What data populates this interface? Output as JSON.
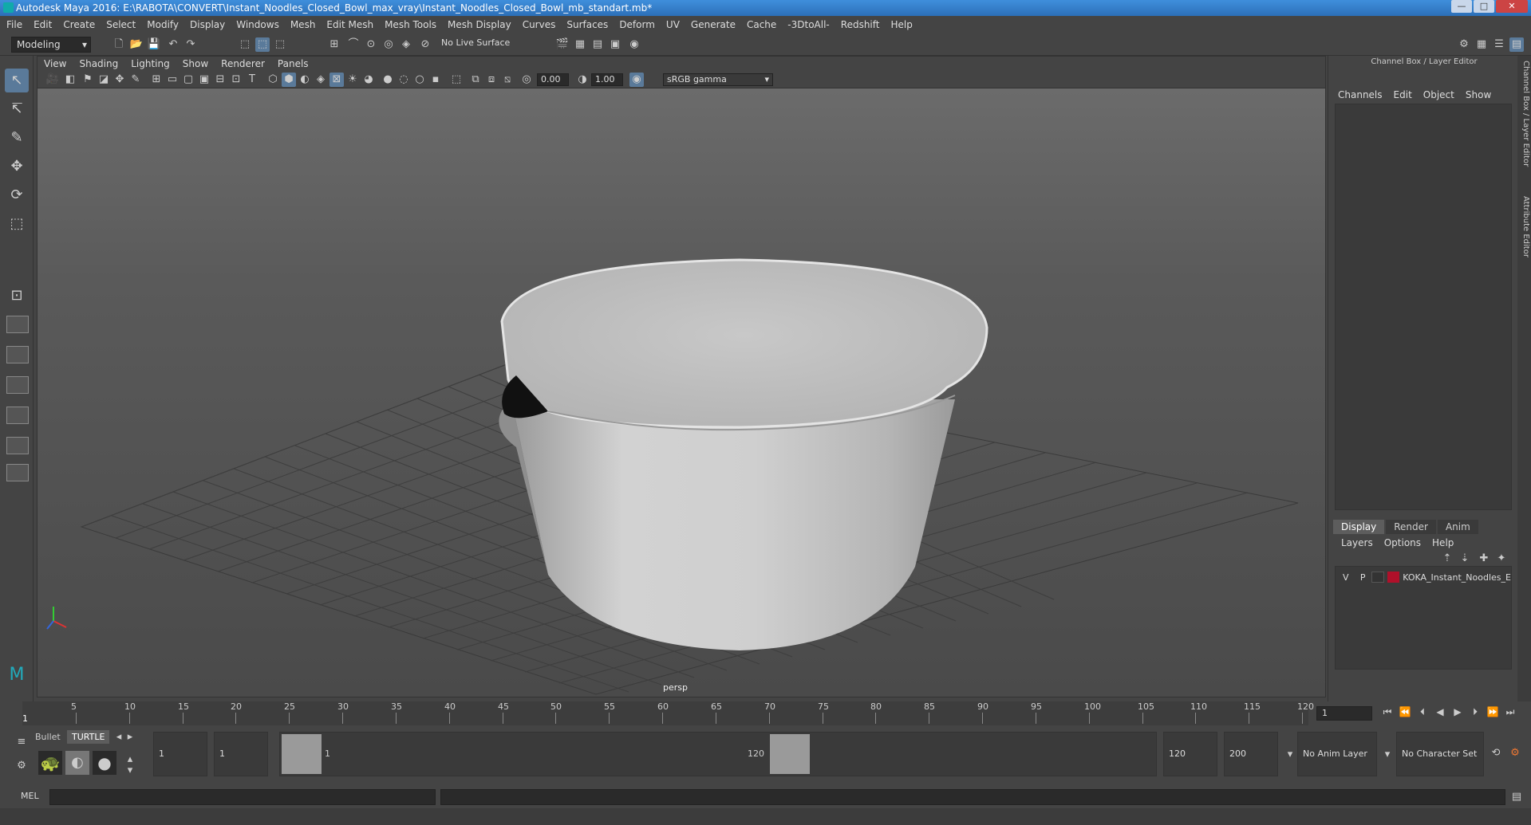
{
  "window": {
    "title": "Autodesk Maya 2016: E:\\RABOTA\\CONVERT\\Instant_Noodles_Closed_Bowl_max_vray\\Instant_Noodles_Closed_Bowl_mb_standart.mb*",
    "minimize": "—",
    "maximize": "□",
    "close": "✕"
  },
  "menubar": [
    "File",
    "Edit",
    "Create",
    "Select",
    "Modify",
    "Display",
    "Windows",
    "Mesh",
    "Edit Mesh",
    "Mesh Tools",
    "Mesh Display",
    "Curves",
    "Surfaces",
    "Deform",
    "UV",
    "Generate",
    "Cache",
    "-3DtoAll-",
    "Redshift",
    "Help"
  ],
  "shelf": {
    "mode": "Modeling",
    "live_surface": "No Live Surface"
  },
  "viewport": {
    "menus": [
      "View",
      "Shading",
      "Lighting",
      "Show",
      "Renderer",
      "Panels"
    ],
    "field_a": "0.00",
    "field_b": "1.00",
    "color_space": "sRGB gamma",
    "camera_label": "persp"
  },
  "channel_box": {
    "title": "Channel Box / Layer Editor",
    "menus": [
      "Channels",
      "Edit",
      "Object",
      "Show"
    ],
    "side_tabs": [
      "Channel Box / Layer Editor",
      "Attribute Editor"
    ]
  },
  "layer_editor": {
    "tabs": [
      "Display",
      "Render",
      "Anim"
    ],
    "active_tab": "Display",
    "menus": [
      "Layers",
      "Options",
      "Help"
    ],
    "layers": [
      {
        "v": "V",
        "p": "P",
        "name": "KOKA_Instant_Noodles_E",
        "color": "#b0102a"
      }
    ]
  },
  "timeline": {
    "ticks": [
      "5",
      "10",
      "15",
      "20",
      "25",
      "30",
      "35",
      "40",
      "45",
      "50",
      "55",
      "60",
      "65",
      "70",
      "75",
      "80",
      "85",
      "90",
      "95",
      "100",
      "105",
      "110",
      "115",
      "120"
    ],
    "start_tick": "1",
    "current_frame": "1"
  },
  "range": {
    "shelf_tabs": [
      "Bullet",
      "TURTLE"
    ],
    "start_a": "1",
    "start_b": "1",
    "range_start_label": "1",
    "range_end_label": "120",
    "end_a": "120",
    "end_b": "200",
    "anim_layer": "No Anim Layer",
    "character_set": "No Character Set"
  },
  "cmdline": {
    "label": "MEL"
  }
}
